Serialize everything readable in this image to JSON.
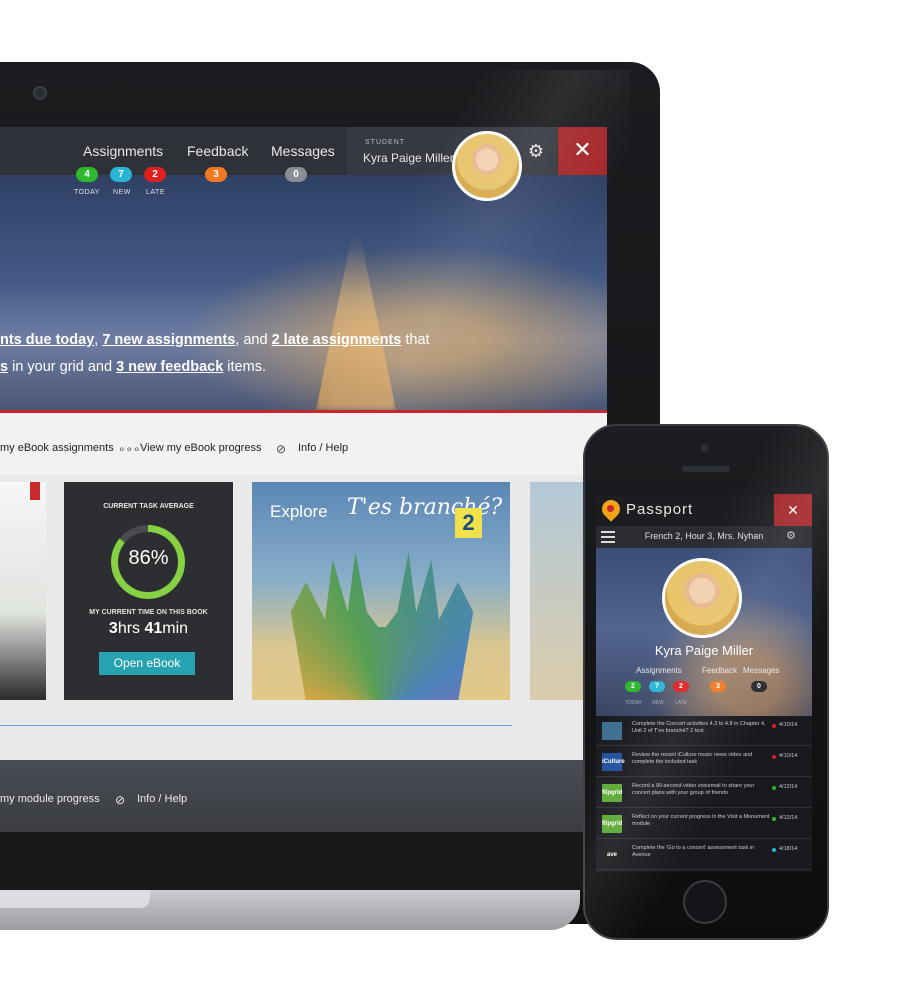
{
  "laptop": {
    "nav": {
      "assignments": "Assignments",
      "feedback": "Feedback",
      "messages": "Messages",
      "badges": {
        "today": {
          "count": "4",
          "label": "TODAY",
          "color": "#2eb82e"
        },
        "new": {
          "count": "7",
          "label": "NEW",
          "color": "#29b6d6"
        },
        "late": {
          "count": "2",
          "label": "LATE",
          "color": "#e0201f"
        },
        "feedback": {
          "count": "3",
          "color": "#f07820"
        },
        "messages": {
          "count": "0",
          "color": "#8a8d93"
        }
      },
      "student_tag": "STUDENT",
      "student_name": "Kyra Paige Miller"
    },
    "hero": {
      "line1_a": "nts due today",
      "line1_b": ", ",
      "line1_c": "7 new assignments",
      "line1_d": ", and ",
      "line1_e": "2 late assignments",
      "line1_f": " that",
      "line2_a": "s",
      "line2_b": " in your grid and ",
      "line2_c": "3 new feedback",
      "line2_d": " items."
    },
    "links": {
      "ebook_assignments": "my eBook assignments",
      "ebook_progress": "View my eBook progress",
      "info_help": "Info / Help"
    },
    "stats_card": {
      "title": "CURRENT TASK AVERAGE",
      "average": "86%",
      "average_value": 86,
      "time_label": "MY CURRENT TIME ON THIS BOOK",
      "time_hrs": "3",
      "time_hrs_unit": "hrs",
      "time_min": "41",
      "time_min_unit": "min",
      "open_button": "Open eBook"
    },
    "cover": {
      "explore": "Explore",
      "title": "T'es branché?",
      "number": "2"
    },
    "bottom": {
      "module_progress": "my module progress",
      "info_help": "Info / Help"
    }
  },
  "phone": {
    "brand": "Passport",
    "class_title": "French 2, Hour 3, Mrs. Nyhan",
    "student_name": "Kyra Paige Miller",
    "nav": {
      "assignments": "Assignments",
      "feedback": "Feedback",
      "messages": "Messages"
    },
    "badges": [
      "2",
      "7",
      "2",
      "3",
      "0"
    ],
    "badge_labels": [
      "TODAY",
      "NEW",
      "LATE"
    ],
    "items": [
      {
        "thumb": "",
        "text": "Complete the Concert activities 4.3 to 4.8 in Chapter 4, Unit 2 of T'es branché? 2 text",
        "date": "4/10/14",
        "dot": "#e0201f",
        "thumb_color": "#3c6e8f"
      },
      {
        "thumb": "iCulture",
        "text": "Review the recent iCulture music news video and complete the included task",
        "date": "4/10/14",
        "dot": "#e0201f",
        "thumb_color": "#1f4f9c"
      },
      {
        "thumb": "flipgrid",
        "text": "Record a 90-second video voicemail to share your concert plans with your group of friends",
        "date": "4/12/14",
        "dot": "#2eb82e",
        "thumb_color": "#5aa832"
      },
      {
        "thumb": "flipgrid",
        "text": "Reflect on your current progress in the Visit a Monument module",
        "date": "4/12/14",
        "dot": "#2eb82e",
        "thumb_color": "#5aa832"
      },
      {
        "thumb": "ave",
        "text": "Complete the 'Go to a concert' assessment task in Avenue",
        "date": "4/18/14",
        "dot": "#29b6d6",
        "thumb_color": "#1a1a1a"
      }
    ]
  }
}
